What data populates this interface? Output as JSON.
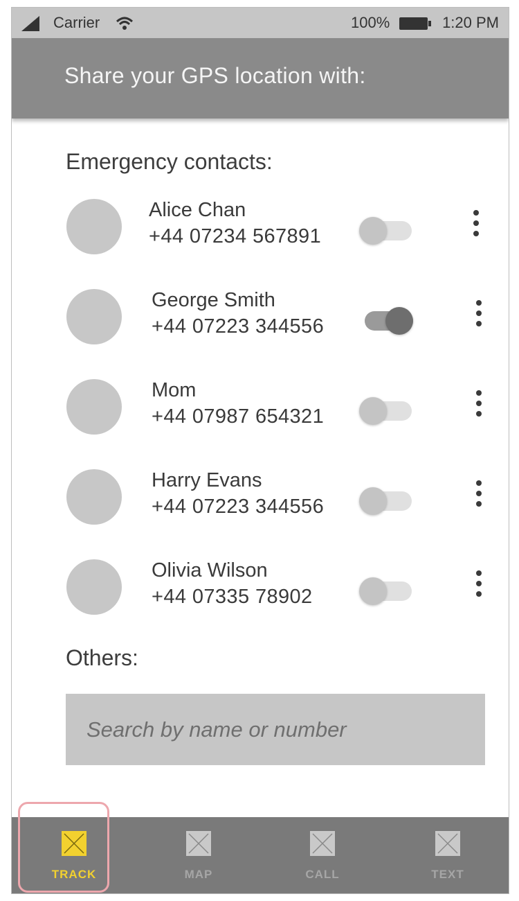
{
  "status_bar": {
    "carrier": "Carrier",
    "battery_percent": "100%",
    "time": "1:20 PM",
    "icons": [
      "signal-icon",
      "wifi-icon",
      "battery-icon"
    ]
  },
  "app_bar": {
    "title": "Share your GPS location with:"
  },
  "emergency": {
    "heading": "Emergency contacts:",
    "contacts": [
      {
        "name": "Alice Chan",
        "phone": "+44 07234 567891",
        "sharing": false
      },
      {
        "name": "George Smith",
        "phone": "+44 07223 344556",
        "sharing": true
      },
      {
        "name": "Mom",
        "phone": "+44 07987 654321",
        "sharing": false
      },
      {
        "name": "Harry Evans",
        "phone": "+44 07223 344556",
        "sharing": false
      },
      {
        "name": "Olivia Wilson",
        "phone": "+44 07335 78902",
        "sharing": false
      }
    ]
  },
  "others": {
    "heading": "Others:",
    "search_placeholder": "Search by name or number"
  },
  "bottom_nav": {
    "items": [
      {
        "label": "TRACK",
        "icon": "track-icon",
        "active": true
      },
      {
        "label": "MAP",
        "icon": "map-icon",
        "active": false
      },
      {
        "label": "CALL",
        "icon": "call-icon",
        "active": false
      },
      {
        "label": "TEXT",
        "icon": "text-icon",
        "active": false
      }
    ]
  },
  "colors": {
    "app_bar": "#8a8a8a",
    "status_bar": "#c6c6c6",
    "bottom_nav": "#7a7a7a",
    "active_accent": "#f2d12f",
    "highlight_outline": "#eda7ad"
  }
}
